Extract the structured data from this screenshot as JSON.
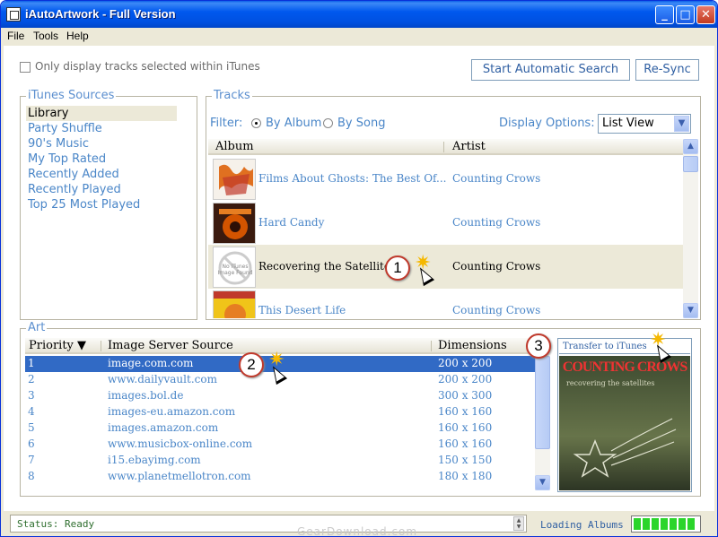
{
  "window": {
    "title": "iAutoArtwork - Full Version",
    "controls": {
      "minimize": "_",
      "maximize": "□",
      "close": "✕"
    }
  },
  "menu": [
    "File",
    "Tools",
    "Help"
  ],
  "top": {
    "only_selected_label": "Only display tracks selected within iTunes",
    "only_selected_checked": false,
    "search_button": "Start Automatic Search",
    "resync_button": "Re-Sync"
  },
  "sources": {
    "legend": "iTunes Sources",
    "items": [
      {
        "label": "Library",
        "selected": true
      },
      {
        "label": "Party Shuffle"
      },
      {
        "label": "90's Music"
      },
      {
        "label": "My Top Rated"
      },
      {
        "label": "Recently Added"
      },
      {
        "label": "Recently Played"
      },
      {
        "label": "Top 25 Most Played"
      }
    ]
  },
  "tracks": {
    "legend": "Tracks",
    "filter_label": "Filter:",
    "by_album": "By Album",
    "by_song": "By Song",
    "display_options_label": "Display Options:",
    "display_options_value": "List View",
    "columns": {
      "album": "Album",
      "artist": "Artist"
    },
    "rows": [
      {
        "album": "Films About Ghosts: The Best Of...",
        "artist": "Counting Crows"
      },
      {
        "album": "Hard Candy",
        "artist": "Counting Crows"
      },
      {
        "album": "Recovering the Satellites",
        "artist": "Counting Crows",
        "selected": true,
        "thumb_text": "No iTunes Image Found"
      },
      {
        "album": "This Desert Life",
        "artist": "Counting Crows"
      }
    ]
  },
  "art": {
    "legend": "Art",
    "columns": {
      "priority": "Priority",
      "source": "Image Server Source",
      "dimensions": "Dimensions"
    },
    "sort_arrow": "▼",
    "rows": [
      {
        "priority": "1",
        "source": "image.com.com",
        "dimensions": "200 x 200",
        "selected": true
      },
      {
        "priority": "2",
        "source": "www.dailyvault.com",
        "dimensions": "200 x 200"
      },
      {
        "priority": "3",
        "source": "images.bol.de",
        "dimensions": "300 x 300"
      },
      {
        "priority": "4",
        "source": "images-eu.amazon.com",
        "dimensions": "160 x 160"
      },
      {
        "priority": "5",
        "source": "images.amazon.com",
        "dimensions": "160 x 160"
      },
      {
        "priority": "6",
        "source": "www.musicbox-online.com",
        "dimensions": "160 x 160"
      },
      {
        "priority": "7",
        "source": "i15.ebayimg.com",
        "dimensions": "150 x 150"
      },
      {
        "priority": "8",
        "source": "www.planetmellotron.com",
        "dimensions": "180 x 180"
      }
    ],
    "transfer_button": "Transfer to iTunes",
    "preview_band": "COUNTING CROWS",
    "preview_subtitle": "recovering the satellites"
  },
  "callouts": [
    "1",
    "2",
    "3"
  ],
  "status": {
    "text": "Status: Ready",
    "loading": "Loading Albums ...",
    "progress": 0.95
  },
  "watermark": "GearDownload.com",
  "colors": {
    "accent": "#4a86c8",
    "selection": "#316ac5",
    "titlebar": "#0058ee"
  }
}
